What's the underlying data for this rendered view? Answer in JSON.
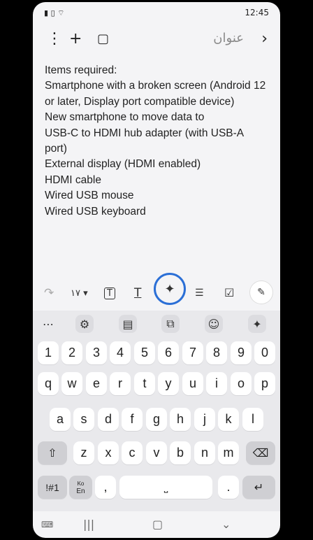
{
  "status": {
    "time": "12:45",
    "icons_left": [
      "battery-icon",
      "sim-icon",
      "wifi-icon"
    ]
  },
  "appbar": {
    "title": "عنوان",
    "icons": [
      "more-vert-icon",
      "plus-icon",
      "book-icon",
      "chevron-right-icon"
    ]
  },
  "note": {
    "lines": [
      "Items required:",
      "Smartphone with a broken screen (Android 12 or later, Display port compatible device)",
      "New smartphone to move data to",
      "USB-C to HDMI hub adapter (with USB-A port)",
      "External display (HDMI enabled)",
      "HDMI cable",
      "Wired USB mouse",
      "Wired USB keyboard"
    ]
  },
  "toolbar": {
    "items": [
      "redo-icon",
      "text-size-icon",
      "text-box-icon",
      "text-format-icon",
      "ai-sparkle-icon",
      "text-style-icon",
      "checkbox-icon",
      "pen-icon"
    ],
    "font_size_label": "١٧"
  },
  "keyboard": {
    "suggest_icons": [
      "more-icon",
      "settings-icon",
      "clipboard-icon",
      "image-icon",
      "emoji-icon",
      "ai-sparkle-icon"
    ],
    "row_numbers": [
      "1",
      "2",
      "3",
      "4",
      "5",
      "6",
      "7",
      "8",
      "9",
      "0"
    ],
    "row1": [
      "q",
      "w",
      "e",
      "r",
      "t",
      "y",
      "u",
      "i",
      "o",
      "p"
    ],
    "row2": [
      "a",
      "s",
      "d",
      "f",
      "g",
      "h",
      "j",
      "k",
      "l"
    ],
    "row3": [
      "z",
      "x",
      "c",
      "v",
      "b",
      "n",
      "m"
    ],
    "symbols_label": "!#1",
    "lang_label": "En",
    "lang_label_sup": "Ko",
    "comma": ",",
    "period": "."
  },
  "nav": {
    "icons": [
      "keyboard-hide-icon",
      "recents-icon",
      "home-icon",
      "back-icon"
    ]
  }
}
